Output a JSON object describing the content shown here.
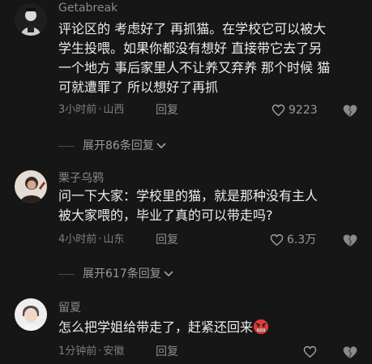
{
  "comments": [
    {
      "username": "Getabreak",
      "lines": [
        "评论区的 考虑好了 再抓猫。在学校它可以被大",
        "学生投喂。如果你都没有想好 直接带它去了另",
        "一个地方 事后家里人不让养又弃养 那个时候 猫",
        "可就遭罪了   所以想好了再抓"
      ],
      "time": "3小时前",
      "location": "山西",
      "reply_label": "回复",
      "likes": "9223",
      "expand_label": "展开86条回复"
    },
    {
      "username": "栗子乌鸦",
      "lines": [
        "问一下大家：学校里的猫，就是那种没有主人",
        "被大家喂的，毕业了真的可以带走吗?"
      ],
      "time": "4小时前",
      "location": "山东",
      "reply_label": "回复",
      "likes": "6.3万",
      "expand_label": "展开617条回复"
    },
    {
      "username": "留夏",
      "lines": [
        "怎么把学姐给带走了，赶紧还回来"
      ],
      "emoji": "angry-face",
      "time": "1分钟前",
      "location": "安徽",
      "reply_label": "回复",
      "likes": ""
    }
  ],
  "separator": "·",
  "colors": {
    "background": "#161616",
    "username": "#8a8a8a",
    "body": "#ececec",
    "meta": "#7d7d7d",
    "emoji_face": "#e23a3a"
  },
  "icons": {
    "like": "heart-outline-icon",
    "dislike": "broken-heart-icon",
    "expand": "chevron-down-icon"
  }
}
